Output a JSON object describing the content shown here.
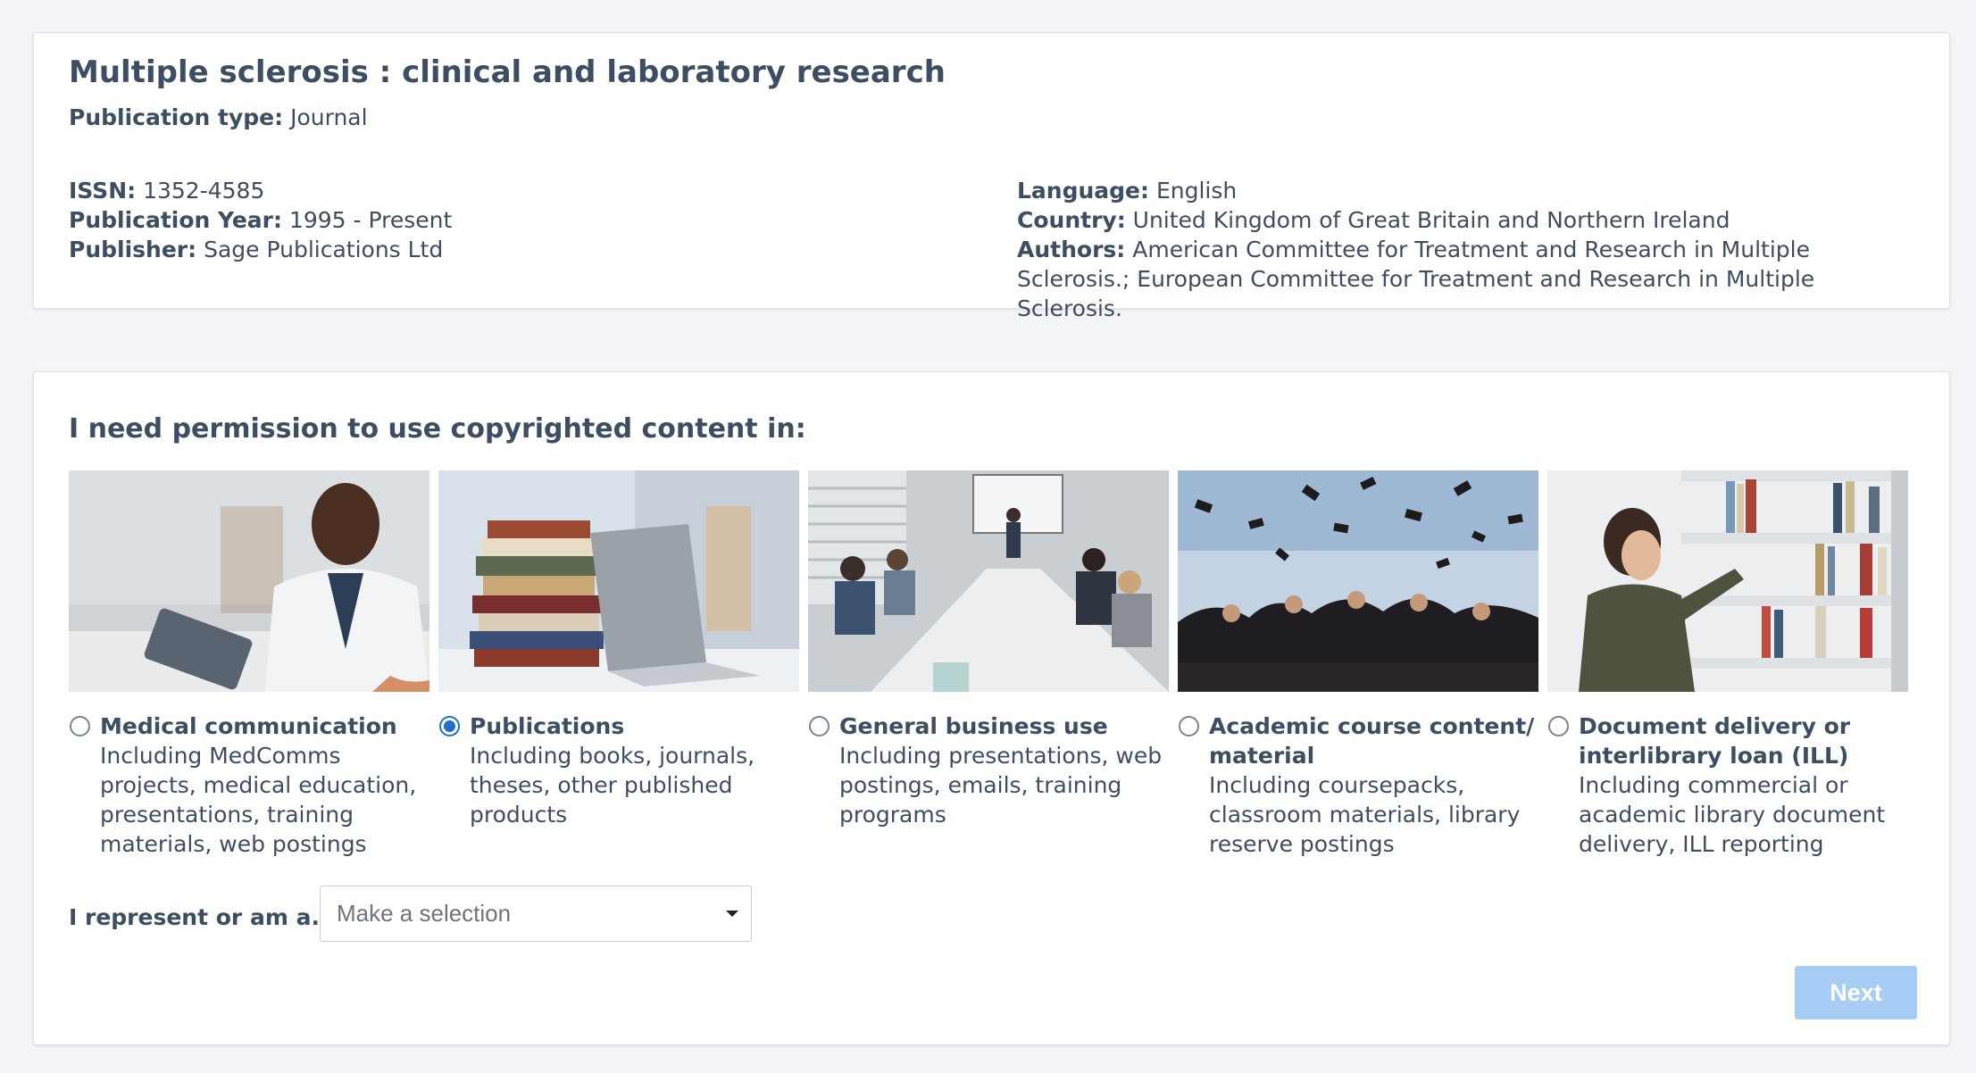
{
  "publication": {
    "title": "Multiple sclerosis : clinical and laboratory research",
    "type_label": "Publication type:",
    "type_value": "Journal",
    "issn_label": "ISSN:",
    "issn_value": "1352-4585",
    "year_label": "Publication Year:",
    "year_value": "1995 - Present",
    "publisher_label": "Publisher:",
    "publisher_value": "Sage Publications Ltd",
    "language_label": "Language:",
    "language_value": "English",
    "country_label": "Country:",
    "country_value": "United Kingdom of Great Britain and Northern Ireland",
    "authors_label": "Authors:",
    "authors_value": "American Committee for Treatment and Research in Multiple Sclerosis.; European Committee for Treatment and Research in Multiple Sclerosis."
  },
  "permission": {
    "heading": "I need permission to use copyrighted content in:",
    "selected": "publications",
    "options": [
      {
        "id": "medical-communication",
        "title": "Medical communication",
        "description": "Including MedComms projects, medical education, presentations, training materials, web postings",
        "checked": false
      },
      {
        "id": "publications",
        "title": "Publications",
        "description": "Including books, journals, theses, other published products",
        "checked": true
      },
      {
        "id": "general-business-use",
        "title": "General business use",
        "description": "Including presentations, web postings, emails, training programs",
        "checked": false
      },
      {
        "id": "academic-course-content",
        "title": "Academic course content/ material",
        "description": "Including coursepacks, classroom materials, library reserve postings",
        "checked": false
      },
      {
        "id": "document-delivery",
        "title": "Document delivery or interlibrary loan (ILL)",
        "description": "Including commercial or academic library document delivery, ILL reporting",
        "checked": false
      }
    ],
    "represent_label": "I represent or am a...",
    "represent_placeholder": "Make a selection",
    "next_label": "Next"
  },
  "colors": {
    "accent": "#1f6fd1",
    "next_button_disabled": "#a8cdf5",
    "heading_text": "#3d4e63",
    "background": "#f4f5f8"
  }
}
